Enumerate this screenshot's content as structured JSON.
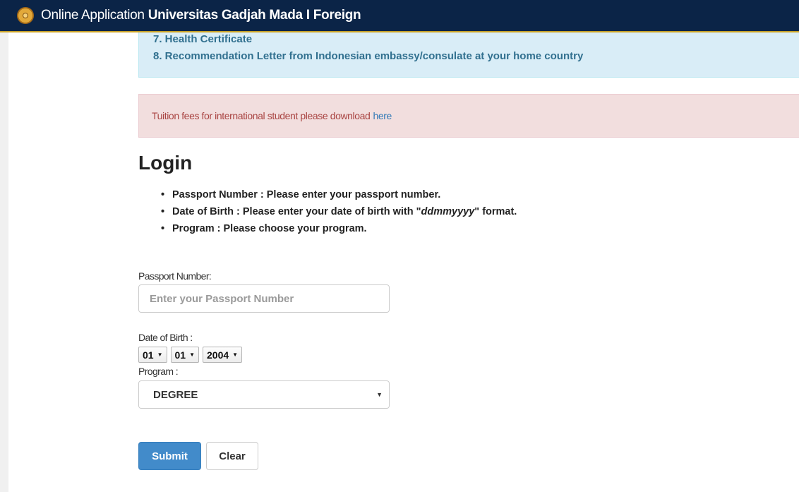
{
  "navbar": {
    "brand_part1": "Online Application",
    "brand_part2": "Universitas Gadjah Mada",
    "brand_part3": "I Foreign"
  },
  "requirements": {
    "item7": "7. Health Certificate",
    "item8": "8. Recommendation Letter from Indonesian embassy/consulate at your home country"
  },
  "alert": {
    "text": "Tuition fees for international student please download",
    "link": "here"
  },
  "login": {
    "title": "Login",
    "rules": [
      "Passport Number : Please enter your passport number.",
      "Date of Birth : Please enter your date of birth with",
      "ddmmyyyy",
      "format.",
      "Program : Please choose your program."
    ]
  },
  "form": {
    "passport_label": "Passport Number:",
    "passport_placeholder": "Enter your Passport Number",
    "dob_label": "Date of Birth :",
    "dob_day": "01",
    "dob_month": "01",
    "dob_year": "2004",
    "program_label": "Program :",
    "program_value": "DEGREE"
  },
  "buttons": {
    "submit": "Submit",
    "clear": "Clear"
  },
  "icons": {
    "logo": "ugm-seal-icon",
    "dropdown": "caret-down-icon"
  }
}
